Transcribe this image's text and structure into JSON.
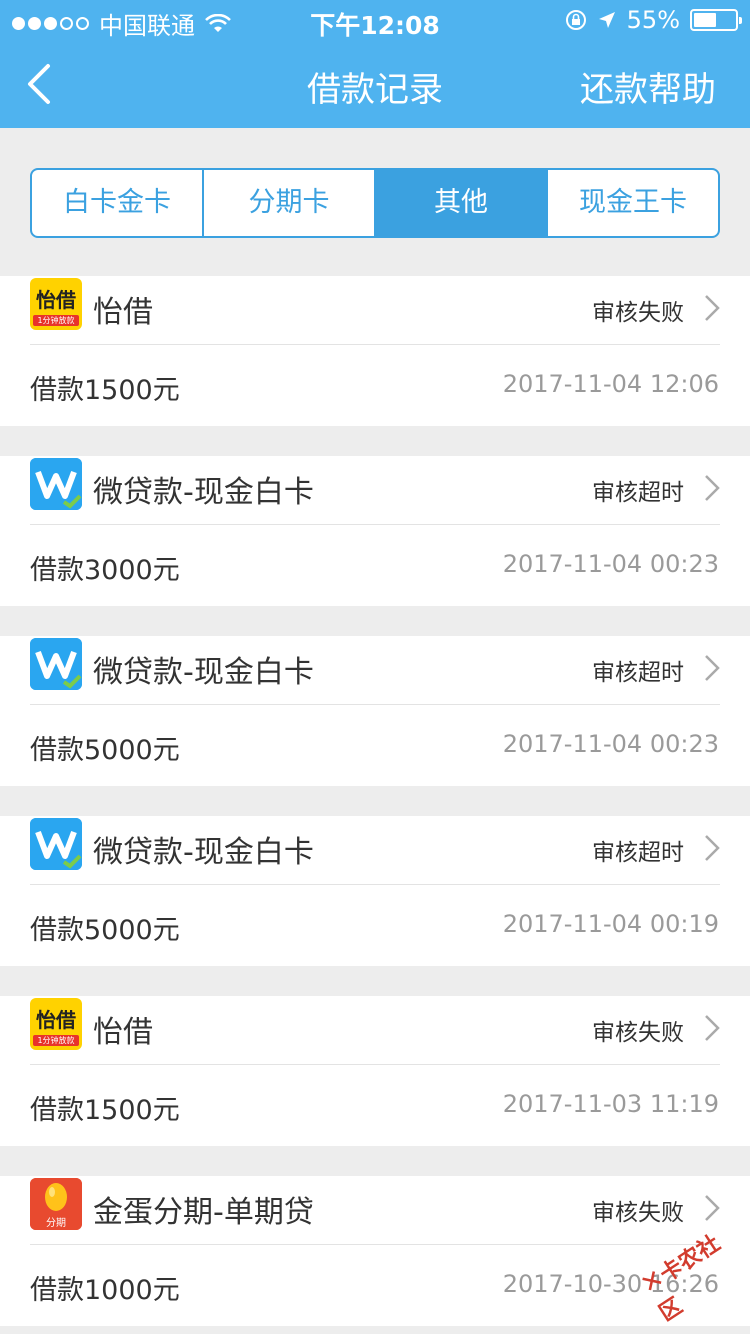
{
  "status_bar": {
    "carrier": "中国联通",
    "time": "下午12:08",
    "battery_text": "55%",
    "battery_level": 0.55
  },
  "nav": {
    "title": "借款记录",
    "help": "还款帮助"
  },
  "tabs": [
    {
      "label": "白卡金卡",
      "active": false
    },
    {
      "label": "分期卡",
      "active": false
    },
    {
      "label": "其他",
      "active": true
    },
    {
      "label": "现金王卡",
      "active": false
    }
  ],
  "records": [
    {
      "logo": "yijie-logo",
      "name": "怡借",
      "status": "审核失败",
      "amount": "借款1500元",
      "date": "2017-11-04 12:06"
    },
    {
      "logo": "weidaikuan-logo",
      "name": "微贷款-现金白卡",
      "status": "审核超时",
      "amount": "借款3000元",
      "date": "2017-11-04 00:23"
    },
    {
      "logo": "weidaikuan-logo",
      "name": "微贷款-现金白卡",
      "status": "审核超时",
      "amount": "借款5000元",
      "date": "2017-11-04 00:23"
    },
    {
      "logo": "weidaikuan-logo",
      "name": "微贷款-现金白卡",
      "status": "审核超时",
      "amount": "借款5000元",
      "date": "2017-11-04 00:19"
    },
    {
      "logo": "yijie-logo",
      "name": "怡借",
      "status": "审核失败",
      "amount": "借款1500元",
      "date": "2017-11-03 11:19"
    },
    {
      "logo": "jindan-logo",
      "name": "金蛋分期-单期贷",
      "status": "审核失败",
      "amount": "借款1000元",
      "date": "2017-10-30 16:26"
    }
  ],
  "logos": {
    "yijie": {
      "main": "怡借",
      "sub": "1分钟放款"
    },
    "jindan": {
      "sub": "分期"
    }
  },
  "watermark": "卡农社区",
  "colors": {
    "accent": "#4fb3ef",
    "tab_active": "#3ba1e0"
  }
}
